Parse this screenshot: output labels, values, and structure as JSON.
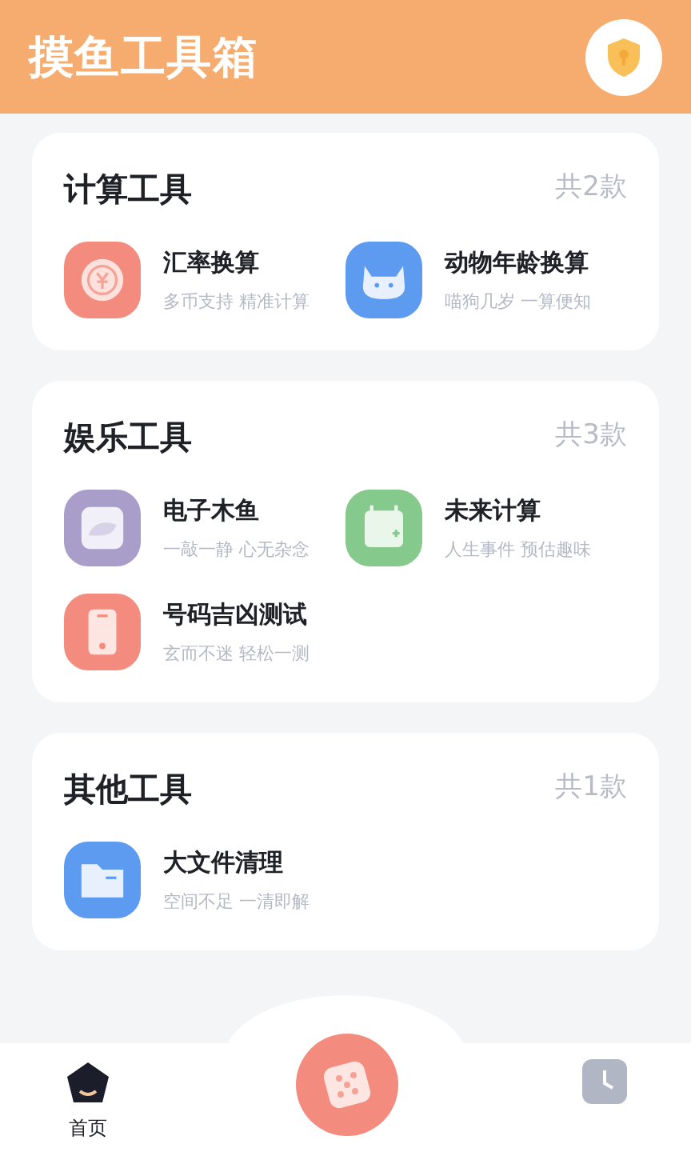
{
  "header": {
    "title": "摸鱼工具箱"
  },
  "sections": [
    {
      "title": "计算工具",
      "count": "共2款",
      "tools": [
        {
          "name": "汇率换算",
          "desc": "多币支持 精准计算",
          "kind": "currency",
          "color": "#f38b7e"
        },
        {
          "name": "动物年龄换算",
          "desc": "喵狗几岁 一算便知",
          "kind": "cat",
          "color": "#5c9bf0"
        }
      ]
    },
    {
      "title": "娱乐工具",
      "count": "共3款",
      "tools": [
        {
          "name": "电子木鱼",
          "desc": "一敲一静 心无杂念",
          "kind": "fish",
          "color": "#a99ec9"
        },
        {
          "name": "未来计算",
          "desc": "人生事件 预估趣味",
          "kind": "calendar",
          "color": "#86c98d"
        },
        {
          "name": "号码吉凶测试",
          "desc": "玄而不迷 轻松一测",
          "kind": "phone",
          "color": "#f38b7e"
        }
      ]
    },
    {
      "title": "其他工具",
      "count": "共1款",
      "tools": [
        {
          "name": "大文件清理",
          "desc": "空间不足 一清即解",
          "kind": "folder",
          "color": "#5c9bf0"
        }
      ]
    }
  ],
  "nav": [
    {
      "kind": "home",
      "label": "首页",
      "selected": true
    },
    {
      "kind": "dice",
      "selected": false
    },
    {
      "kind": "clock",
      "selected": false
    }
  ]
}
